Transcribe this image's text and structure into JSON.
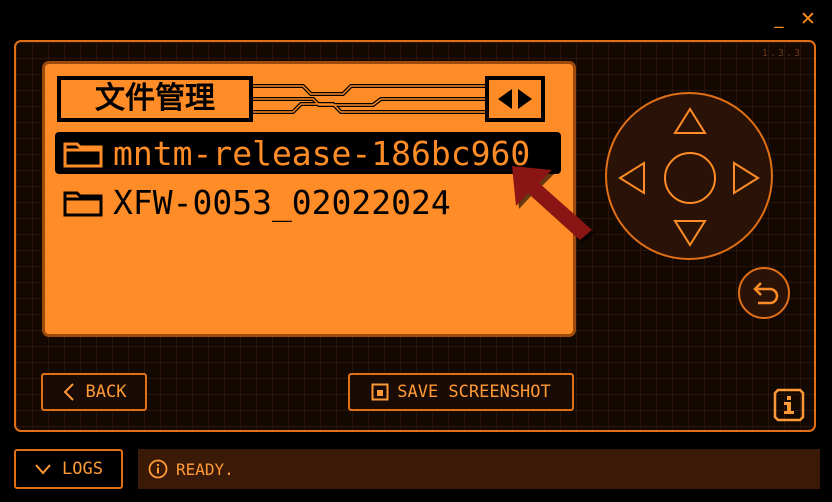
{
  "window": {
    "minimize_label": "_",
    "close_label": "✕"
  },
  "device": {
    "version": "1.3.3"
  },
  "screen": {
    "title": "文件管理",
    "files": [
      {
        "name": "mntm-release-186bc960",
        "selected": true
      },
      {
        "name": "XFW-0053_02022024",
        "selected": false
      }
    ]
  },
  "controls": {
    "back_label": "BACK",
    "save_label": "SAVE SCREENSHOT",
    "logs_label": "LOGS"
  },
  "status": {
    "text": "READY."
  },
  "icons": {
    "folder": "folder-icon",
    "dpad": [
      "dpad-up-icon",
      "dpad-down-icon",
      "dpad-left-icon",
      "dpad-right-icon",
      "dpad-center"
    ],
    "return": "return-icon",
    "info": "info-icon",
    "chevron_left": "chevron-left-icon",
    "chevron_down": "chevron-down-icon",
    "save": "save-icon",
    "annotation_arrow": "annotation-arrow-icon"
  },
  "colors": {
    "accent": "#ff8c26",
    "border": "#e06f16",
    "status_bg": "#3a1a07",
    "annotation": "#8b1414"
  }
}
